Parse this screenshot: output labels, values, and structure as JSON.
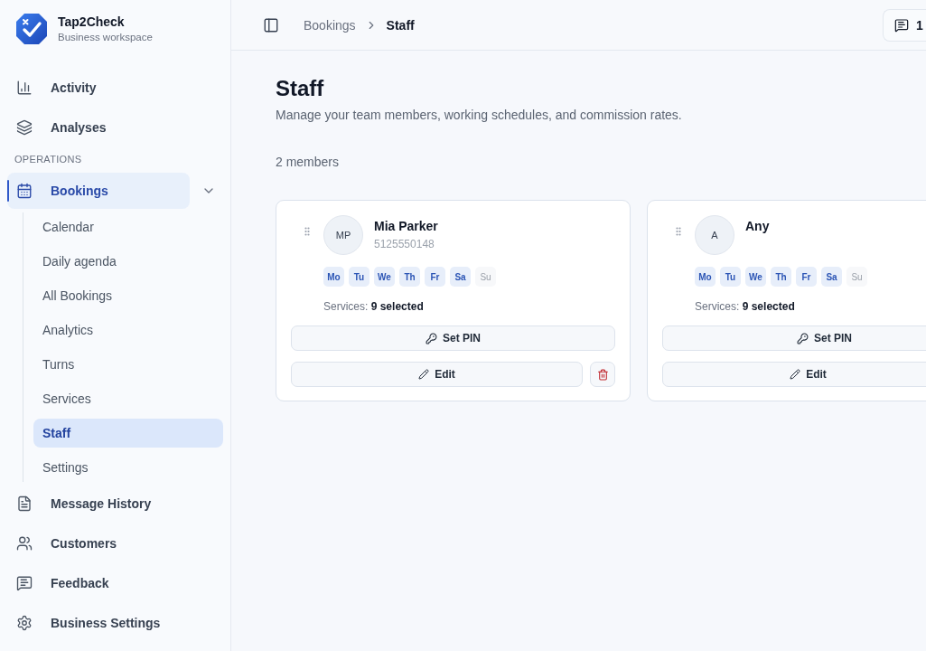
{
  "brand": {
    "name": "Tap2Check",
    "subtitle": "Business workspace"
  },
  "sidebar": {
    "items": [
      {
        "kind": "link",
        "label": "Activity",
        "selected": false
      },
      {
        "kind": "link",
        "label": "Analyses",
        "selected": false
      },
      {
        "kind": "heading",
        "label": "OPERATIONS"
      },
      {
        "kind": "group",
        "label": "Bookings",
        "selected": true,
        "expanded": true,
        "children": [
          {
            "label": "Calendar",
            "selected": false
          },
          {
            "label": "Daily agenda",
            "selected": false
          },
          {
            "label": "All Bookings",
            "selected": false
          },
          {
            "label": "Analytics",
            "selected": false
          },
          {
            "label": "Turns",
            "selected": false
          },
          {
            "label": "Services",
            "selected": false
          },
          {
            "label": "Staff",
            "selected": true
          },
          {
            "label": "Settings",
            "selected": false
          }
        ]
      },
      {
        "kind": "link",
        "label": "Message History",
        "selected": false
      },
      {
        "kind": "link",
        "label": "Customers",
        "selected": false
      },
      {
        "kind": "link",
        "label": "Feedback",
        "selected": false
      },
      {
        "kind": "link",
        "label": "Business Settings",
        "selected": false
      }
    ]
  },
  "topbar": {
    "breadcrumb": [
      {
        "label": "Bookings",
        "current": false
      },
      {
        "label": "Staff",
        "current": true
      }
    ],
    "messages_count": "1"
  },
  "page": {
    "title": "Staff",
    "description": "Manage your team members, working schedules, and commission rates.",
    "member_count": "2 members"
  },
  "members": [
    {
      "initials": "MP",
      "name": "Mia Parker",
      "phone": "5125550148",
      "days": [
        {
          "label": "Mo",
          "on": true
        },
        {
          "label": "Tu",
          "on": true
        },
        {
          "label": "We",
          "on": true
        },
        {
          "label": "Th",
          "on": true
        },
        {
          "label": "Fr",
          "on": true
        },
        {
          "label": "Sa",
          "on": true
        },
        {
          "label": "Su",
          "on": false
        }
      ],
      "services": "Services: **9 selected**",
      "pin_button": "Set PIN",
      "edit_button": "Edit"
    },
    {
      "initials": "A",
      "name": "Any",
      "days": [
        {
          "label": "Mo",
          "on": true
        },
        {
          "label": "Tu",
          "on": true
        },
        {
          "label": "We",
          "on": true
        },
        {
          "label": "Th",
          "on": true
        },
        {
          "label": "Fr",
          "on": true
        },
        {
          "label": "Sa",
          "on": true
        },
        {
          "label": "Su",
          "on": false
        }
      ],
      "services": "Services: **9 selected**",
      "pin_button": "Set PIN",
      "edit_button": "Edit"
    }
  ]
}
